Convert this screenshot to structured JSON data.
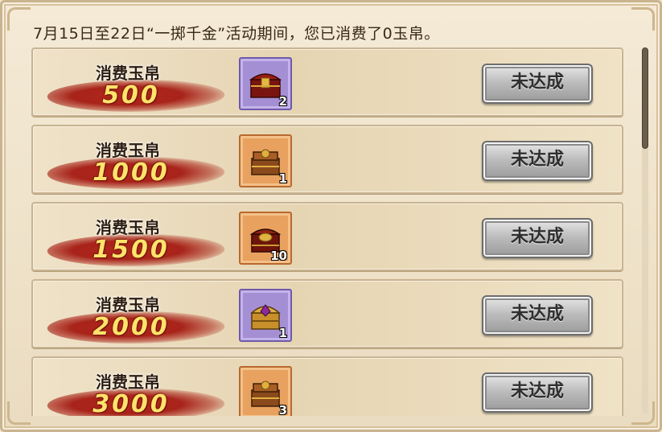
{
  "info_text": "7月15日至22日“一掷千金”活动期间，您已消费了0玉帛。",
  "rows": [
    {
      "label": "消费玉帛",
      "amount": "500",
      "item_icon": "purple-treasure-chest-icon",
      "item_count": "2",
      "button": "未达成"
    },
    {
      "label": "消费玉帛",
      "amount": "1000",
      "item_icon": "orange-treasure-chest-icon",
      "item_count": "1",
      "button": "未达成"
    },
    {
      "label": "消费玉帛",
      "amount": "1500",
      "item_icon": "red-treasure-chest-icon",
      "item_count": "10",
      "button": "未达成"
    },
    {
      "label": "消费玉帛",
      "amount": "2000",
      "item_icon": "golden-treasure-chest-icon",
      "item_count": "1",
      "button": "未达成"
    },
    {
      "label": "消费玉帛",
      "amount": "3000",
      "item_icon": "orange-treasure-chest-icon",
      "item_count": "3",
      "button": "未达成"
    }
  ],
  "colors": {
    "brush": "#b2281d",
    "amount_text": "#ffe36b",
    "purple_slot": "#a58fd4",
    "orange_slot": "#e8a15e"
  }
}
